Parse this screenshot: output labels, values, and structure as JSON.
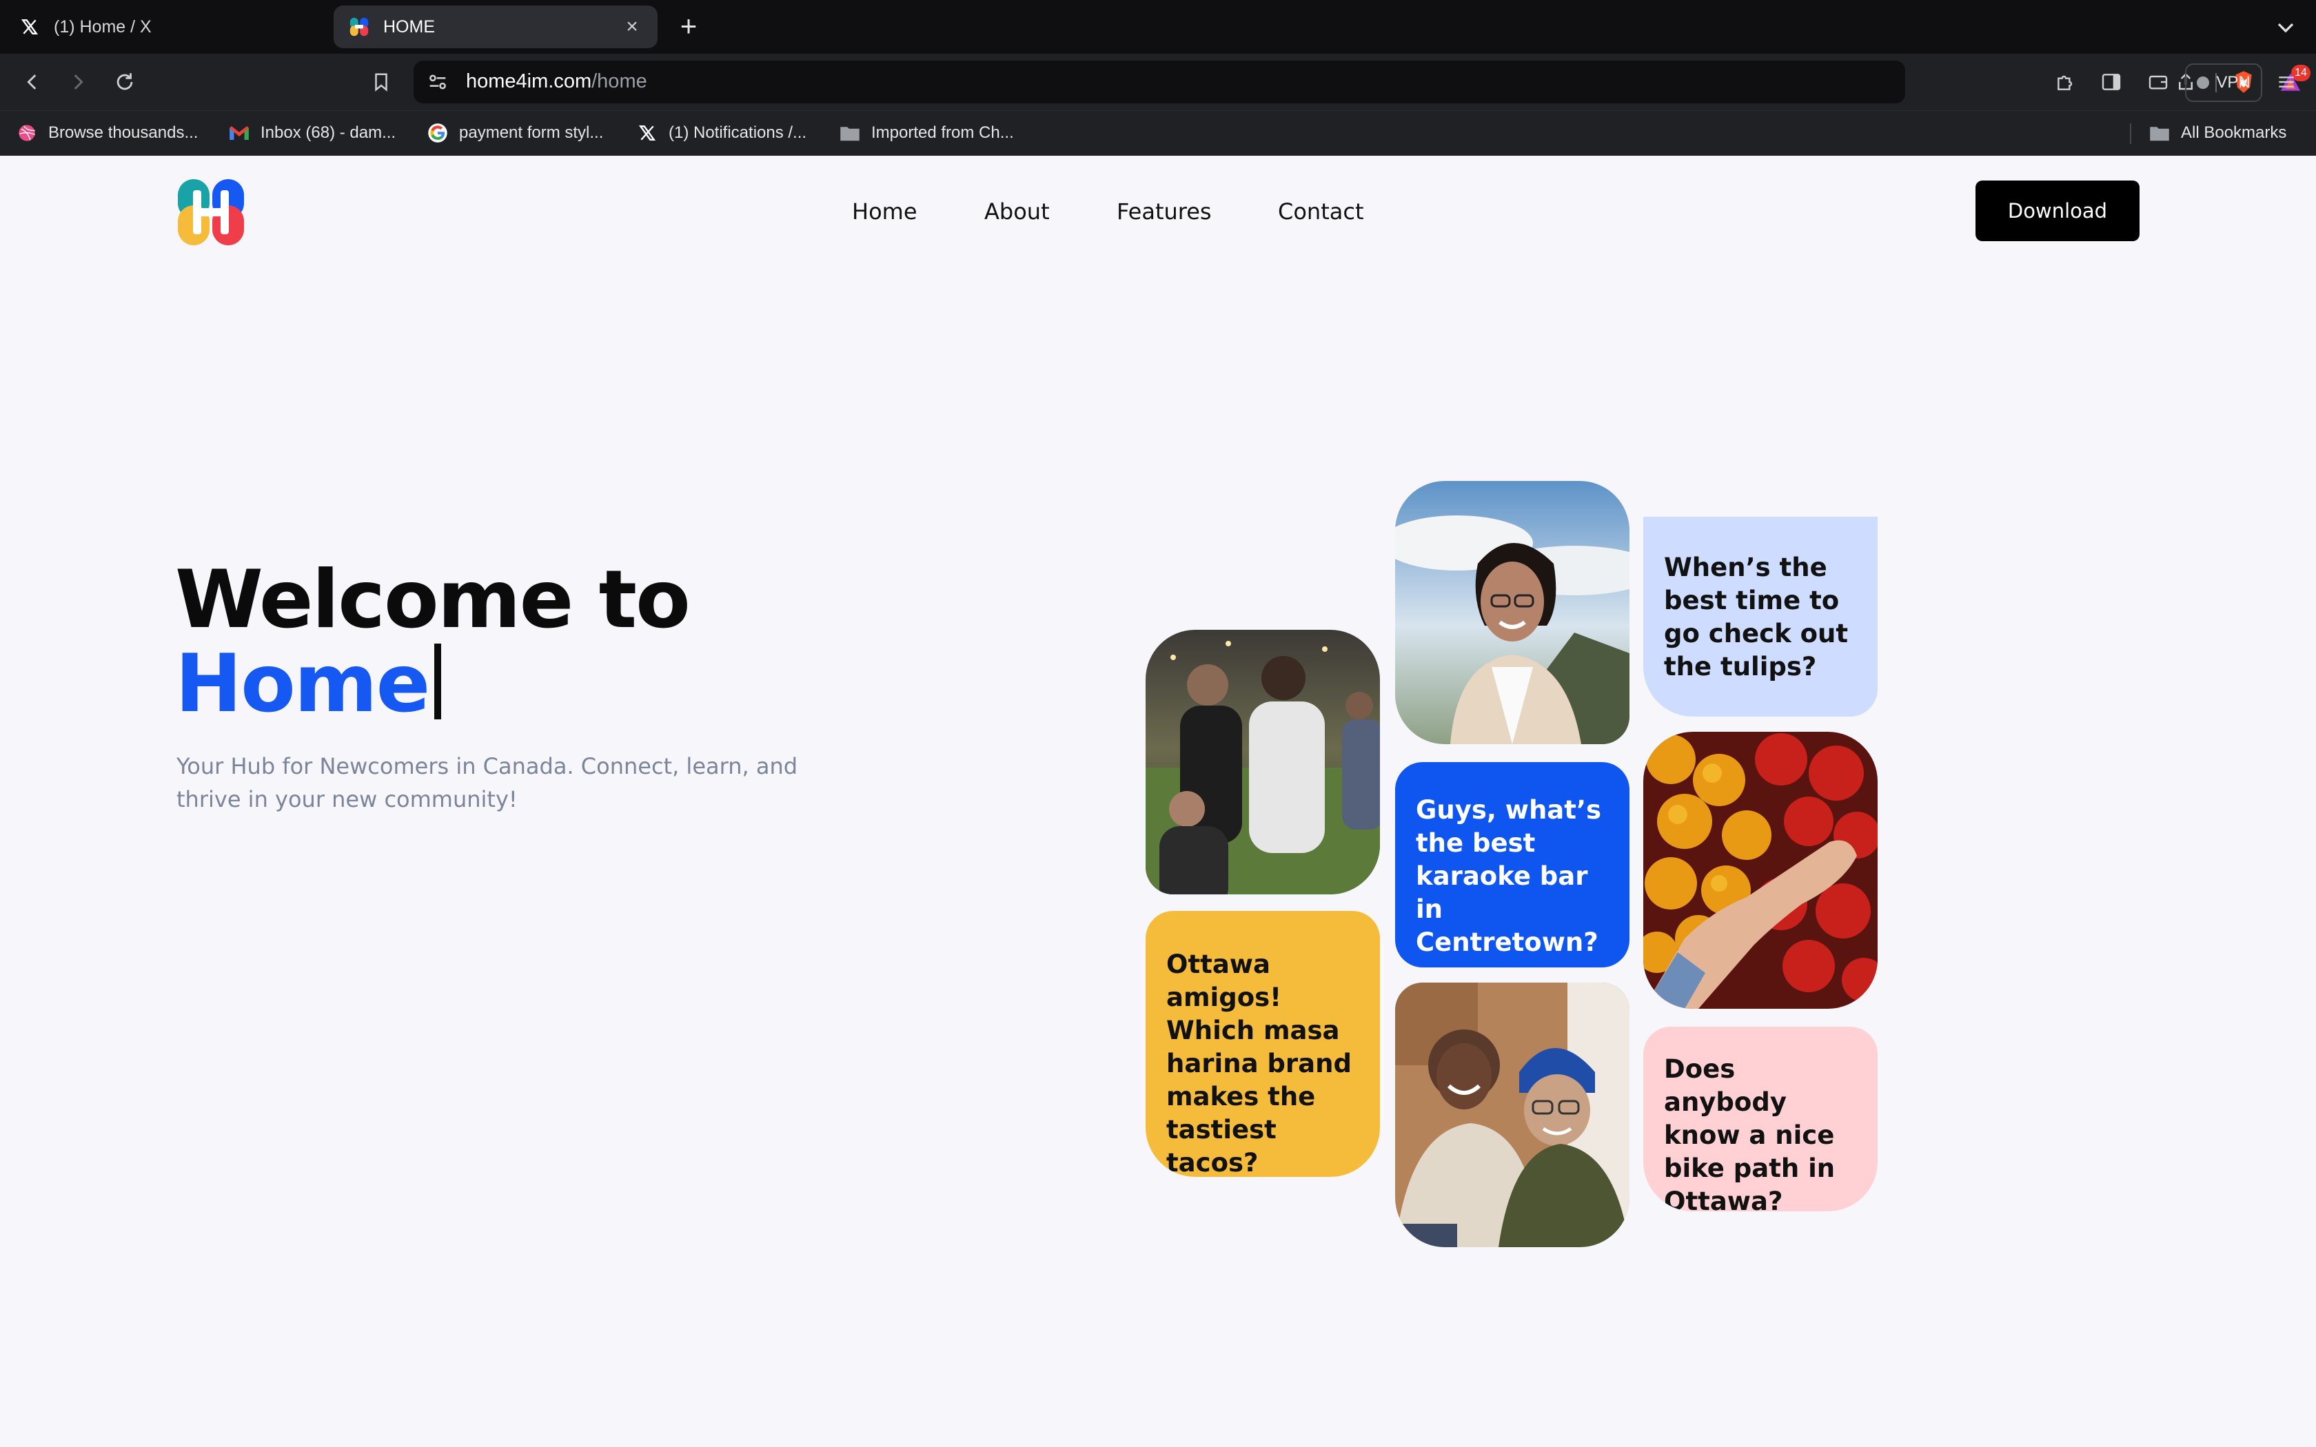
{
  "browser": {
    "tabs": [
      {
        "title": "(1) Home / X",
        "icon": "x-logo-icon",
        "active": false
      },
      {
        "title": "HOME",
        "icon": "home4im-favicon-icon",
        "active": true
      }
    ],
    "new_tab": "+",
    "close": "×",
    "url_domain": "home4im.com",
    "url_path": "/home",
    "notification_badge": "14",
    "vpn_label": "VPN",
    "bookmarks": [
      {
        "label": "Browse thousands...",
        "icon": "dribbble-icon"
      },
      {
        "label": "Inbox (68) - dam...",
        "icon": "gmail-icon"
      },
      {
        "label": "payment form styl...",
        "icon": "google-icon"
      },
      {
        "label": "(1) Notifications /...",
        "icon": "x-logo-icon"
      },
      {
        "label": "Imported from Ch...",
        "icon": "folder-icon"
      }
    ],
    "all_bookmarks": "All Bookmarks"
  },
  "site": {
    "nav": [
      "Home",
      "About",
      "Features",
      "Contact"
    ],
    "download": "Download",
    "hero": {
      "title_line1": "Welcome to",
      "title_line2": "Home",
      "subtitle": "Your Hub for Newcomers in Canada. Connect, learn, and thrive in your new community!"
    },
    "cards": {
      "tulips": "When’s the best time to go check out the tulips?",
      "karaoke": "Guys, what’s the best karaoke bar in Centretown?",
      "masa": "Ottawa amigos! Which masa harina brand makes the tastiest tacos?",
      "bike": "Does anybody know a nice bike path in Ottawa?"
    },
    "photos": [
      "group-of-friends-photo",
      "smiling-woman-photo",
      "peppers-photo",
      "laughing-friends-photo"
    ]
  },
  "colors": {
    "accent_blue": "#1558f2",
    "card_lavender": "#cddcff",
    "card_blue": "#0f55f0",
    "card_yellow": "#f5bc3c",
    "card_pink": "#ffd1d4",
    "button_black": "#000000"
  }
}
